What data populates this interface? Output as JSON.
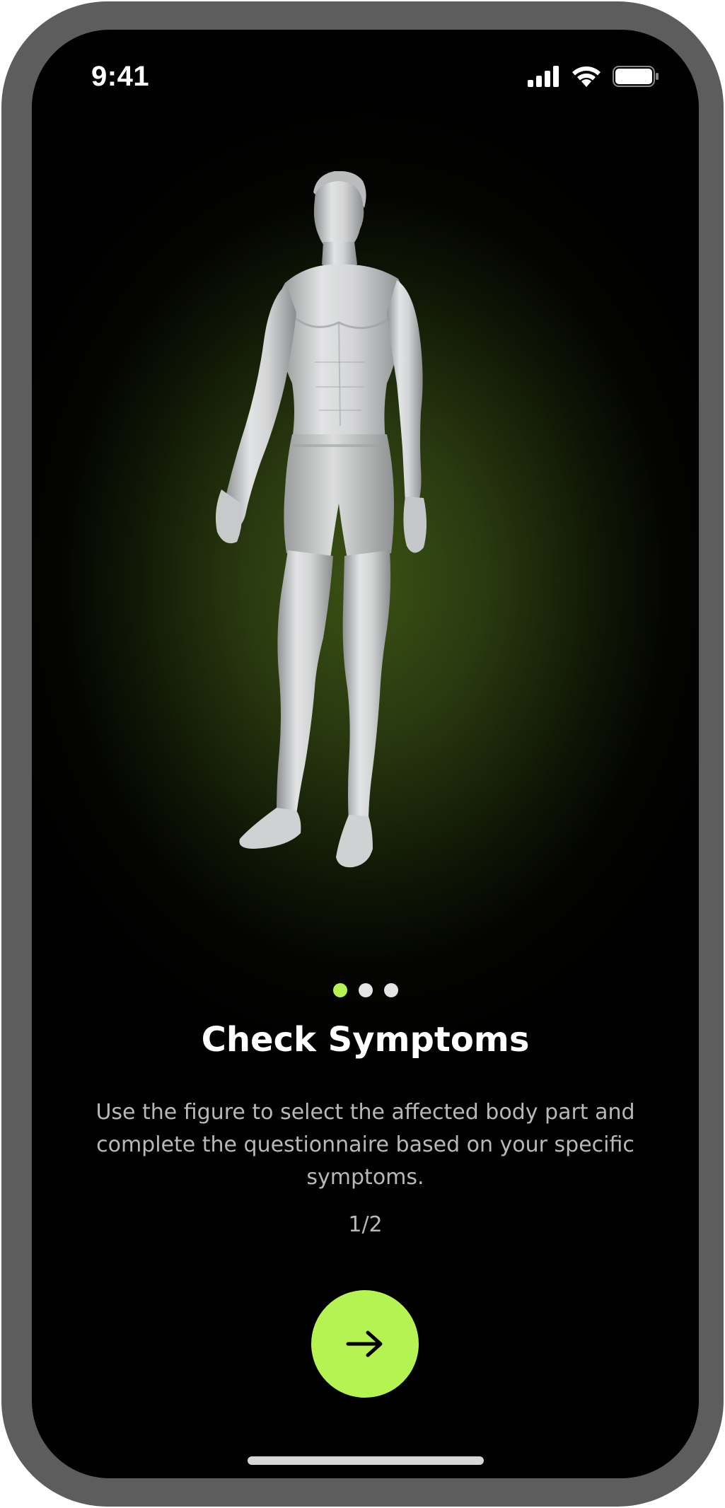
{
  "status_bar": {
    "time": "9:41",
    "icons": [
      "cellular-signal-icon",
      "wifi-icon",
      "battery-icon"
    ]
  },
  "onboarding": {
    "illustration": "human-body-figure",
    "pager": {
      "total": 3,
      "active_index": 0
    },
    "title": "Check Symptoms",
    "description": "Use the figure to select the affected body part and complete the questionnaire based on your specific symptoms.",
    "step_counter": "1/2",
    "next_button_icon": "arrow-right-icon"
  },
  "colors": {
    "accent": "#b4f352",
    "background": "#000000",
    "glow": "#3a5214",
    "title_text": "#ffffff",
    "body_text": "#b8b8b8",
    "frame": "#5d5d5d"
  }
}
